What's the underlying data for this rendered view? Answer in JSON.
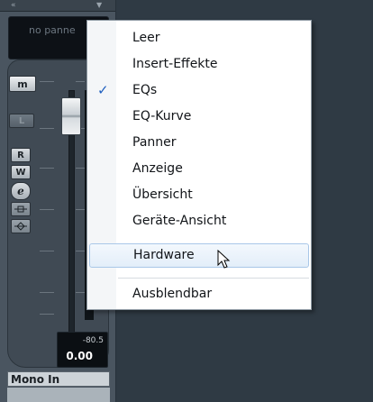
{
  "channel": {
    "panner_text": "no panne",
    "buttons": {
      "monitor": "m",
      "listen": "L",
      "read": "R",
      "write": "W",
      "edit": "e"
    },
    "peak_value": "-80.5",
    "volume_value": "0.00",
    "input_label": "Mono In"
  },
  "context_menu": {
    "items": [
      {
        "label": "Leer",
        "checked": false
      },
      {
        "label": "Insert-Effekte",
        "checked": false
      },
      {
        "label": "EQs",
        "checked": true
      },
      {
        "label": "EQ-Kurve",
        "checked": false
      },
      {
        "label": "Panner",
        "checked": false
      },
      {
        "label": "Anzeige",
        "checked": false
      },
      {
        "label": "Übersicht",
        "checked": false
      },
      {
        "label": "Geräte-Ansicht",
        "checked": false
      },
      {
        "label": "Hardware",
        "checked": false,
        "hovered": true
      },
      {
        "label": "Ausblendbar",
        "checked": false
      }
    ],
    "check_glyph": "✓"
  },
  "colors": {
    "menu_hover_border": "#a9c7e8",
    "check_color": "#1f5fbf",
    "strip_background": "#4a5560"
  }
}
